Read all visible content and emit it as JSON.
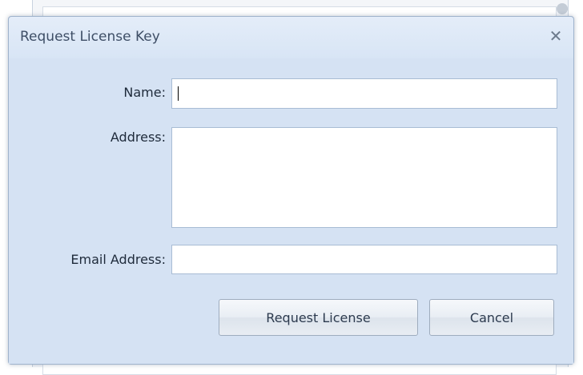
{
  "dialog": {
    "title": "Request License Key",
    "close_glyph": "✕"
  },
  "form": {
    "name_label": "Name:",
    "name_value": "",
    "address_label": "Address:",
    "address_value": "",
    "email_label": "Email Address:",
    "email_value": ""
  },
  "buttons": {
    "request_label": "Request License",
    "cancel_label": "Cancel"
  },
  "icons": {
    "close": "close-icon"
  }
}
